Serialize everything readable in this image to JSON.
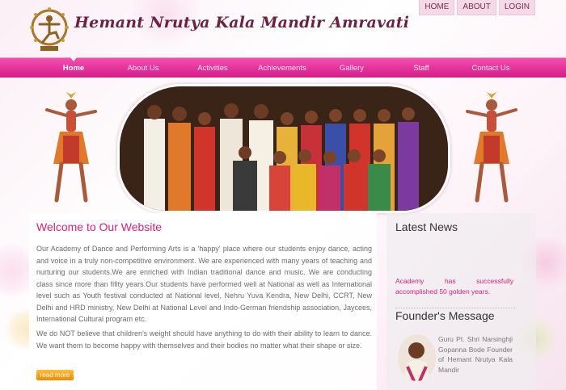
{
  "header": {
    "site_title": "Hemant Nrutya Kala Mandir Amravati",
    "top_links": [
      "HOME",
      "ABOUT",
      "LOGIN"
    ]
  },
  "nav": {
    "items": [
      "Home",
      "About Us",
      "Activities",
      "Achievements",
      "Gallery",
      "Staff",
      "Contact Us"
    ],
    "active": "Home"
  },
  "main": {
    "title": "Welcome to Our Website",
    "paragraph1": "Our Academy of Dance and Performing Arts is a 'happy' place where our students enjoy dance, acting and voice in a truly non-competitive environment. We are experienced with many years of teaching and nurturing our students.We are enriched with Indian traditional dance and music. We are conducting class since more than fifity years.Our students have performed well at National as well as International level such as Youth festival conducted at National level, Nehru Yuva Kendra, New Delhi, CCRT, New Delhi and HRD ministry, New Delhi at National Level and Indo-German friendship association, Jaycees, International Cultural program etc.",
    "paragraph2": "We do NOT believe that children's weight should have anything to do with their ability to learn to dance. We want them to become happy with themselves and their bodies no matter what their shape or size.",
    "read_more": "read more"
  },
  "sidebar": {
    "news_title": "Latest News",
    "news_text": "Academy has successfully accomplished 50 golden years.",
    "founder_title": "Founder's Message",
    "founder_text": "Guru Pt. Shri Narsinghji Gopanna Bode Founder of Hemant Nrutya Kala Mandir"
  },
  "colors": {
    "accent": "#d4217f",
    "nav": "#e32e98",
    "title": "#6b2340"
  }
}
